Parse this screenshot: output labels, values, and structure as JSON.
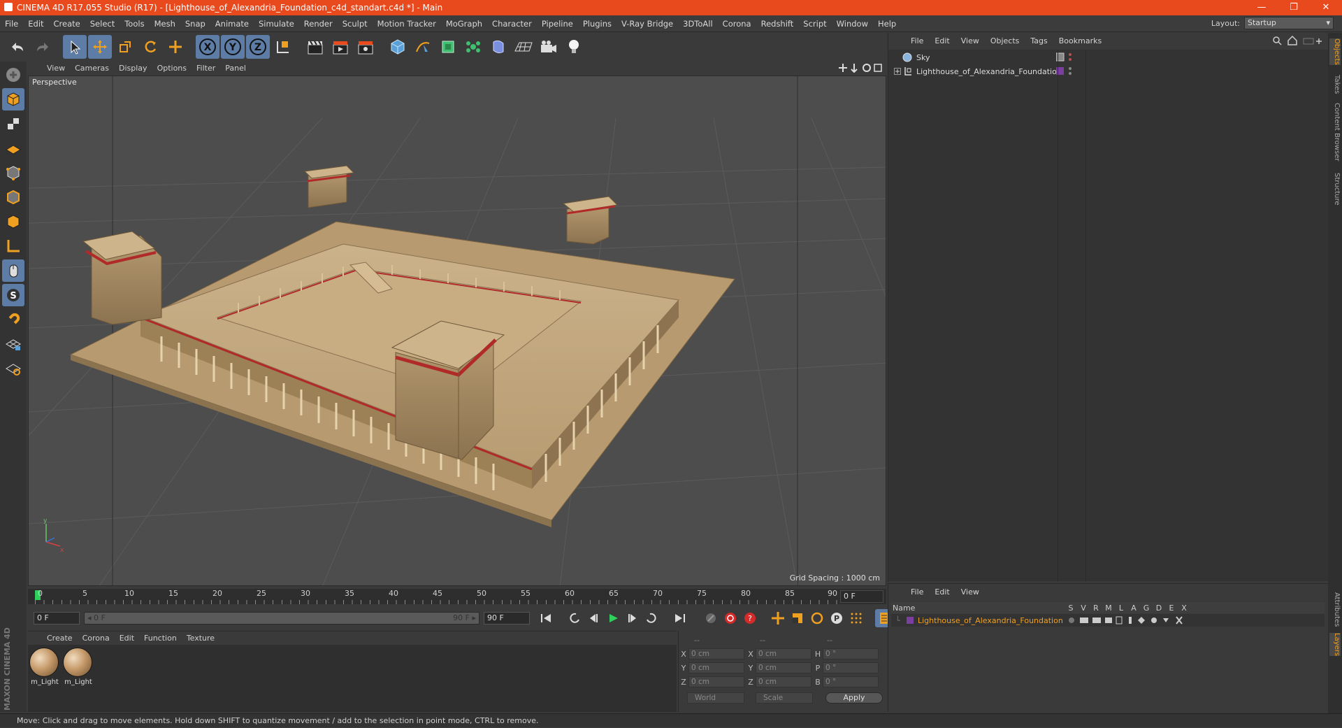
{
  "window": {
    "title": "CINEMA 4D R17.055 Studio (R17) - [Lighthouse_of_Alexandria_Foundation_c4d_standart.c4d *] - Main",
    "controls": [
      "—",
      "❐",
      "✕"
    ]
  },
  "menubar": {
    "items": [
      "File",
      "Edit",
      "Create",
      "Select",
      "Tools",
      "Mesh",
      "Snap",
      "Animate",
      "Simulate",
      "Render",
      "Sculpt",
      "Motion Tracker",
      "MoGraph",
      "Character",
      "Pipeline",
      "Plugins",
      "V-Ray Bridge",
      "3DToAll",
      "Corona",
      "Redshift",
      "Script",
      "Window",
      "Help"
    ],
    "layout_label": "Layout:",
    "layout_value": "Startup"
  },
  "viewport": {
    "menu": [
      "View",
      "Cameras",
      "Display",
      "Options",
      "Filter",
      "Panel"
    ],
    "label": "Perspective",
    "grid_spacing": "Grid Spacing : 1000 cm"
  },
  "timeline": {
    "ticks": [
      "0",
      "5",
      "10",
      "15",
      "20",
      "25",
      "30",
      "35",
      "40",
      "45",
      "50",
      "55",
      "60",
      "65",
      "70",
      "75",
      "80",
      "85",
      "90"
    ],
    "current_frame": "0 F",
    "start_field": "0 F",
    "slider_start": "◂ 0 F",
    "slider_end": "90 F ▸",
    "end_field": "90 F"
  },
  "materials": {
    "menu": [
      "Create",
      "Corona",
      "Edit",
      "Function",
      "Texture"
    ],
    "items": [
      {
        "name": "m_Light"
      },
      {
        "name": "m_Light"
      }
    ]
  },
  "coordinates": {
    "header": [
      "--",
      "--",
      "--"
    ],
    "rows": [
      {
        "l1": "X",
        "v1": "0 cm",
        "l2": "X",
        "v2": "0 cm",
        "l3": "H",
        "v3": "0 °"
      },
      {
        "l1": "Y",
        "v1": "0 cm",
        "l2": "Y",
        "v2": "0 cm",
        "l3": "P",
        "v3": "0 °"
      },
      {
        "l1": "Z",
        "v1": "0 cm",
        "l2": "Z",
        "v2": "0 cm",
        "l3": "B",
        "v3": "0 °"
      }
    ],
    "mode": "World",
    "transform": "Scale",
    "apply": "Apply"
  },
  "objects": {
    "menu": [
      "File",
      "Edit",
      "View",
      "Objects",
      "Tags",
      "Bookmarks"
    ],
    "items": [
      {
        "name": "Sky"
      },
      {
        "name": "Lighthouse_of_Alexandria_Foundation"
      }
    ]
  },
  "side_tabs": [
    "Objects",
    "Takes",
    "Content Browser",
    "Structure"
  ],
  "side_tabs_bottom": [
    "Attributes",
    "Layers"
  ],
  "layers": {
    "menu": [
      "File",
      "Edit",
      "View"
    ],
    "header_name": "Name",
    "columns": [
      "S",
      "V",
      "R",
      "M",
      "L",
      "A",
      "G",
      "D",
      "E",
      "X"
    ],
    "row_name": "Lighthouse_of_Alexandria_Foundation",
    "row_color": "#7b3fa0"
  },
  "status": "Move: Click and drag to move elements. Hold down SHIFT to quantize movement / add to the selection in point mode, CTRL to remove.",
  "colors": {
    "titlebar": "#e8491d",
    "active_tool": "#5d7da6",
    "highlight_orange": "#f0a020"
  },
  "brand": "MAXON CINEMA 4D"
}
